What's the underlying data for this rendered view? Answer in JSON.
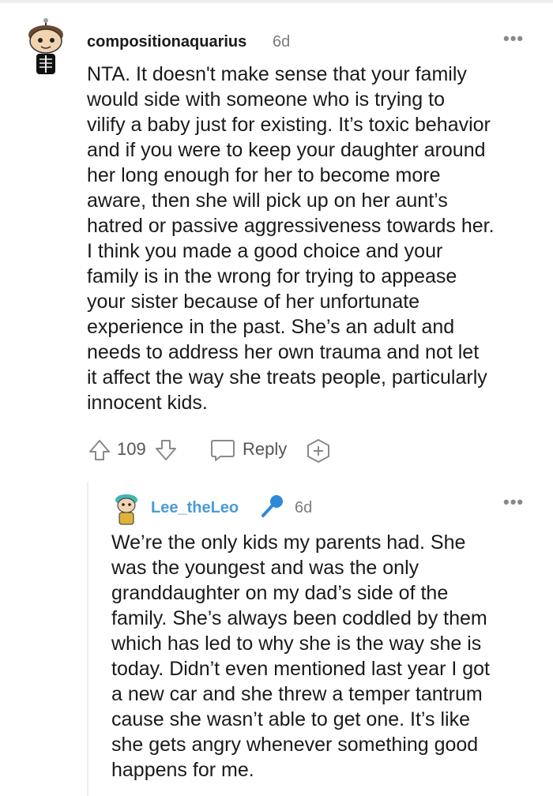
{
  "comments": [
    {
      "username": "compositionaquarius",
      "time": "6d",
      "more_icon": "more-options-icon",
      "body": "NTA. It doesn't make sense that your family\nwould side with someone who is trying to\nvilify a baby just for existing. It’s toxic behavior\nand if you were to keep your daughter around\nher long enough for her to become more\naware, then she will pick up on her aunt’s\nhatred or passive aggressiveness towards her.\nI think you made a good choice and your\nfamily is in the wrong for trying to appease\nyour sister because of her unfortunate\nexperience in the past. She’s an adult and\nneeds to address her own trauma and not let\nit affect the way she treats people, particularly\ninnocent kids.",
      "score": "109",
      "reply_label": "Reply"
    },
    {
      "username": "Lee_theLeo",
      "time": "6d",
      "badge_icon": "microphone-icon",
      "more_icon": "more-options-icon",
      "body": "We’re the only kids my parents had. She\nwas the youngest and was the only\ngranddaughter on my dad’s side of the\nfamily. She’s always been coddled by them\nwhich has led to why she is the way she is\ntoday. Didn’t even mentioned last year I got\na new car and she threw a temper tantrum\ncause she wasn’t able to get one. It’s like\nshe gets angry whenever something good\nhappens for me."
    }
  ],
  "colors": {
    "username2": "#4a9bd6",
    "mic": "#2e8ad8",
    "meta": "#7c7c7c",
    "icon": "#878a8c"
  }
}
